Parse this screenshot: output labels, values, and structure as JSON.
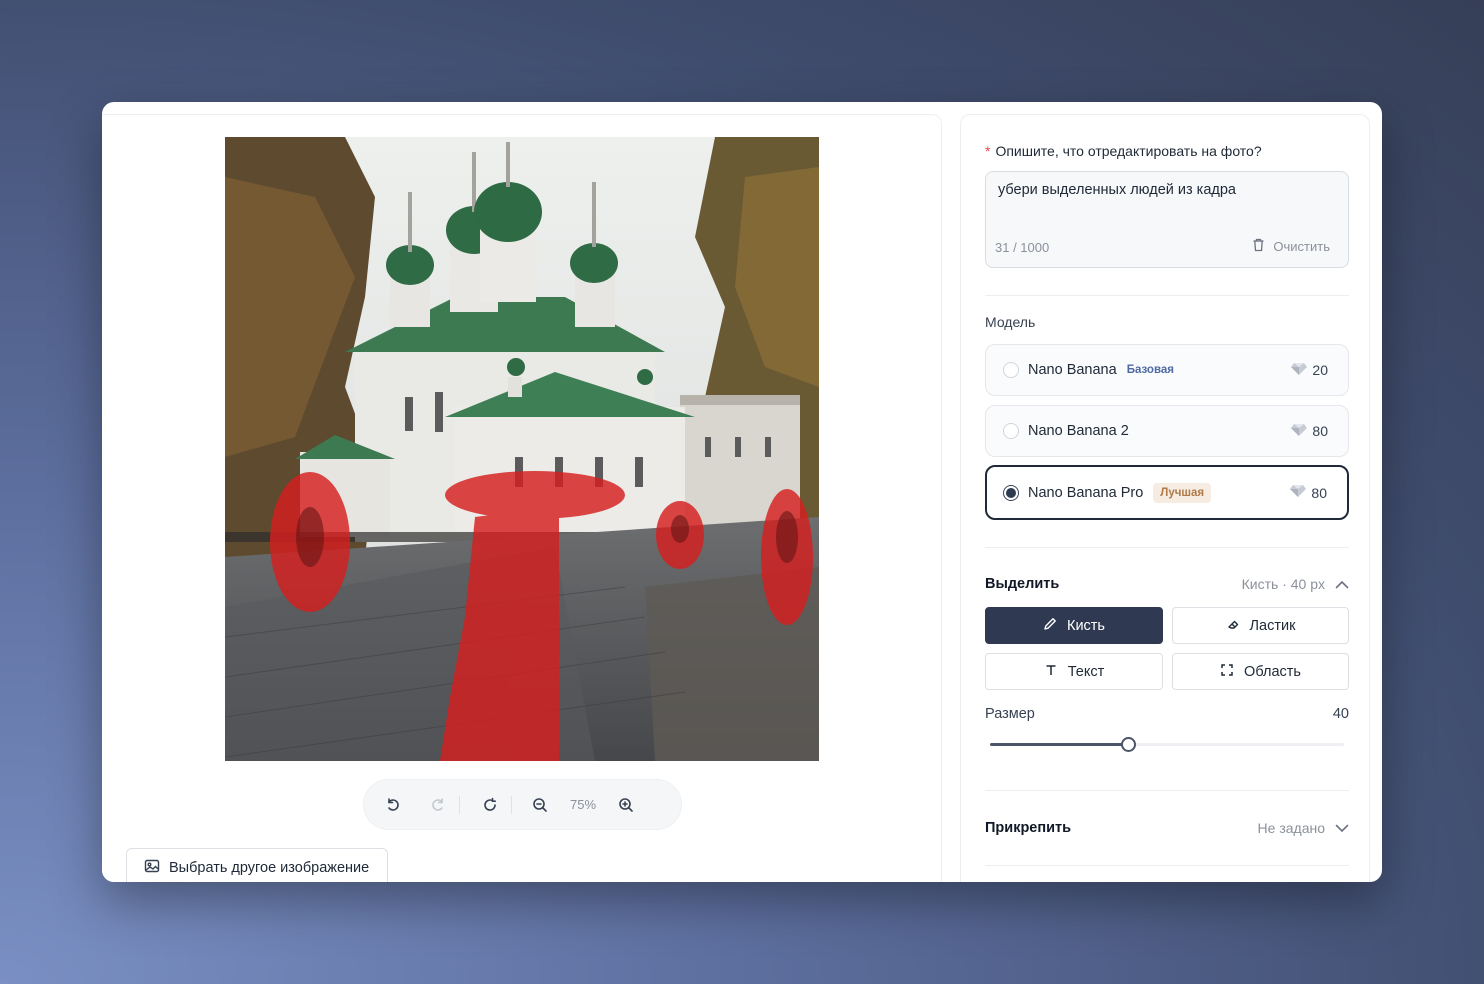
{
  "editor": {
    "toolbar": {
      "undo_icon": "undo-icon",
      "redo_icon": "redo-icon",
      "reset_icon": "reset-icon",
      "zoom_out_icon": "zoom-out-icon",
      "zoom_level": "75%",
      "zoom_in_icon": "zoom-in-icon"
    },
    "choose_image_label": "Выбрать другое изображение"
  },
  "prompt": {
    "question": "Опишите, что отредактировать на фото?",
    "required_mark": "*",
    "value": "убери выделенных людей из кадра",
    "counter": "31 / 1000",
    "clear_label": "Очистить"
  },
  "model": {
    "label": "Модель",
    "options": [
      {
        "name": "Nano Banana",
        "badge": "Базовая",
        "cost": "20",
        "selected": false
      },
      {
        "name": "Nano Banana 2",
        "badge": "",
        "cost": "80",
        "selected": false
      },
      {
        "name": "Nano Banana Pro",
        "badge": "Лучшая",
        "cost": "80",
        "selected": true
      }
    ]
  },
  "select": {
    "title": "Выделить",
    "summary": "Кисть · 40 px",
    "tools": {
      "brush": "Кисть",
      "eraser": "Ластик",
      "text": "Текст",
      "area": "Область"
    },
    "size_label": "Размер",
    "size_value": "40",
    "size_fraction": 0.39
  },
  "attach": {
    "title": "Прикрепить",
    "value": "Не задано"
  },
  "colors": {
    "accent": "#2f3a52",
    "mask": "#d61f1f",
    "best_badge": "#b07a4a",
    "basic_badge": "#4f6aa3"
  }
}
